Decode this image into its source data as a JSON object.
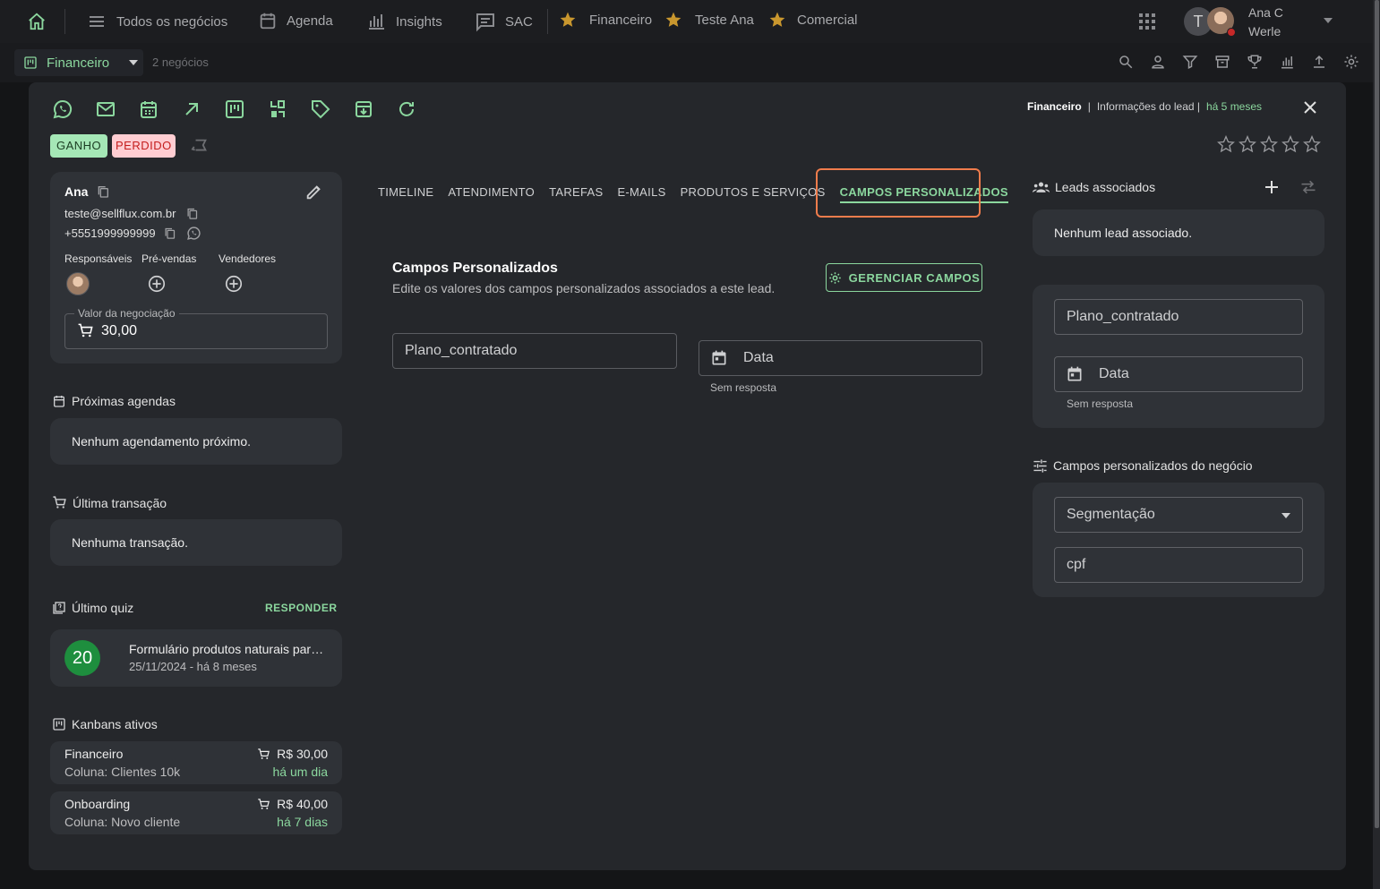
{
  "topnav": {
    "items": [
      {
        "label": "Todos os negócios"
      },
      {
        "label": "Agenda"
      },
      {
        "label": "Insights"
      },
      {
        "label": "SAC"
      },
      {
        "label": "Financeiro"
      },
      {
        "label": "Teste Ana"
      },
      {
        "label": "Comercial"
      }
    ],
    "user": {
      "initial": "T",
      "name": "Ana C Werle"
    }
  },
  "subbar": {
    "board": "Financeiro",
    "count": "2 negócios"
  },
  "modal": {
    "breadcrumb": {
      "board": "Financeiro",
      "sep": "|",
      "section": "Informações do lead |",
      "time": "há 5 meses"
    },
    "status": {
      "won": "GANHO",
      "lost": "PERDIDO"
    },
    "contact": {
      "name": "Ana",
      "email": "teste@sellflux.com.br",
      "phone": "+5551999999999",
      "roles": {
        "responsaveis": "Responsáveis",
        "prevendas": "Pré-vendas",
        "vendedores": "Vendedores"
      },
      "deal_value_label": "Valor da negociação",
      "deal_value": "30,00"
    },
    "agenda": {
      "title": "Próximas agendas",
      "empty": "Nenhum agendamento próximo."
    },
    "transaction": {
      "title": "Última transação",
      "empty": "Nenhuma transação."
    },
    "quiz": {
      "title": "Último quiz",
      "action": "RESPONDER",
      "score": "20",
      "name": "Formulário produtos naturais para emagrecer",
      "date": "25/11/2024 - há 8 meses"
    },
    "kanbans": {
      "title": "Kanbans ativos",
      "items": [
        {
          "name": "Financeiro",
          "column": "Coluna: Clientes 10k",
          "value": "R$ 30,00",
          "time": "há um dia"
        },
        {
          "name": "Onboarding",
          "column": "Coluna: Novo cliente",
          "value": "R$ 40,00",
          "time": "há 7 dias"
        }
      ]
    },
    "tabs": [
      "TIMELINE",
      "ATENDIMENTO",
      "TAREFAS",
      "E-MAILS",
      "PRODUTOS E SERVIÇOS",
      "CAMPOS PERSONALIZADOS"
    ],
    "active_tab": "CAMPOS PERSONALIZADOS",
    "custom_fields": {
      "title": "Campos Personalizados",
      "subtitle": "Edite os valores dos campos personalizados associados a este lead.",
      "manage_button": "GERENCIAR CAMPOS",
      "plan_placeholder": "Plano_contratado",
      "date_placeholder": "Data",
      "date_helper": "Sem resposta"
    },
    "leads": {
      "title": "Leads associados",
      "empty": "Nenhum lead associado."
    },
    "lead_fields": {
      "plan_placeholder": "Plano_contratado",
      "date_placeholder": "Data",
      "date_helper": "Sem resposta"
    },
    "deal_fields": {
      "title": "Campos personalizados do negócio",
      "segment_placeholder": "Segmentação",
      "cpf_placeholder": "cpf"
    }
  },
  "colors": {
    "accent": "#8bd79e",
    "highlight": "#f07c4c",
    "won": "#a5e7b6",
    "lost": "#ffcdd2"
  }
}
